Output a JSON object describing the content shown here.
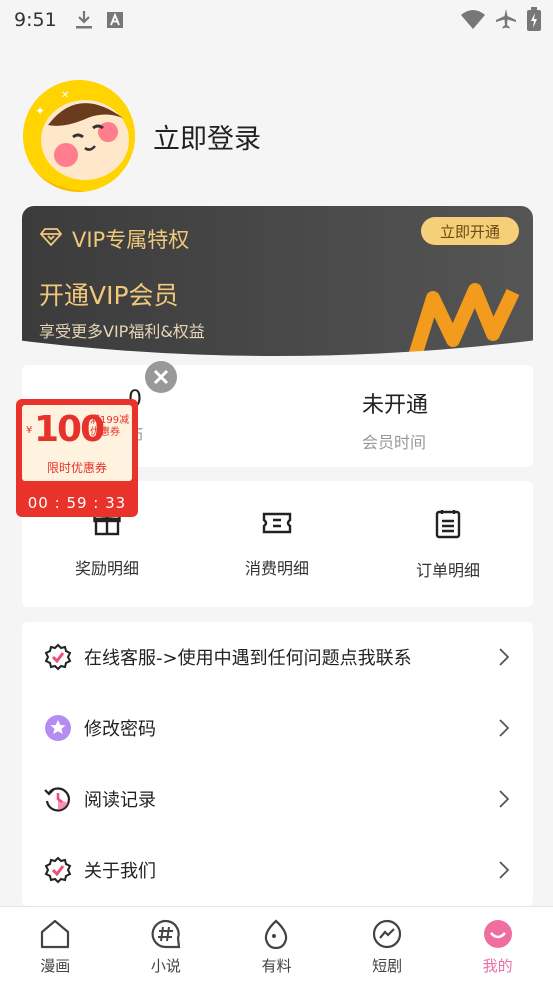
{
  "status_bar": {
    "time": "9:51"
  },
  "profile": {
    "login_label": "立即登录"
  },
  "vip": {
    "title": "VIP专属特权",
    "open_button": "立即开通",
    "headline": "开通VIP会员",
    "subtitle": "享受更多VIP福利&权益"
  },
  "stats": [
    {
      "value": "0",
      "label": "币"
    },
    {
      "value": "未开通",
      "label": "会员时间"
    }
  ],
  "actions": [
    {
      "label": "奖励明细",
      "icon": "gift-icon"
    },
    {
      "label": "消费明细",
      "icon": "ticket-icon"
    },
    {
      "label": "订单明细",
      "icon": "order-list-icon"
    }
  ],
  "menu": [
    {
      "label": "在线客服->使用中遇到任何问题点我联系",
      "icon": "badge-check-icon"
    },
    {
      "label": "修改密码",
      "icon": "star-badge-icon"
    },
    {
      "label": "阅读记录",
      "icon": "history-icon"
    },
    {
      "label": "关于我们",
      "icon": "badge-check-icon"
    }
  ],
  "coupon": {
    "amount": "100",
    "currency": "¥",
    "condition_line1": "满199减",
    "condition_line2": "优惠券",
    "name": "限时优惠券",
    "timer": "00 : 59 : 33"
  },
  "tabs": [
    {
      "label": "漫画",
      "icon": "home-icon"
    },
    {
      "label": "小说",
      "icon": "hashtag-icon"
    },
    {
      "label": "有料",
      "icon": "egg-icon"
    },
    {
      "label": "短剧",
      "icon": "trend-icon"
    },
    {
      "label": "我的",
      "icon": "smile-icon"
    }
  ],
  "colors": {
    "accent": "#ee6ea0",
    "vip_gold": "#f0c87a",
    "coupon_red": "#e8322a"
  }
}
